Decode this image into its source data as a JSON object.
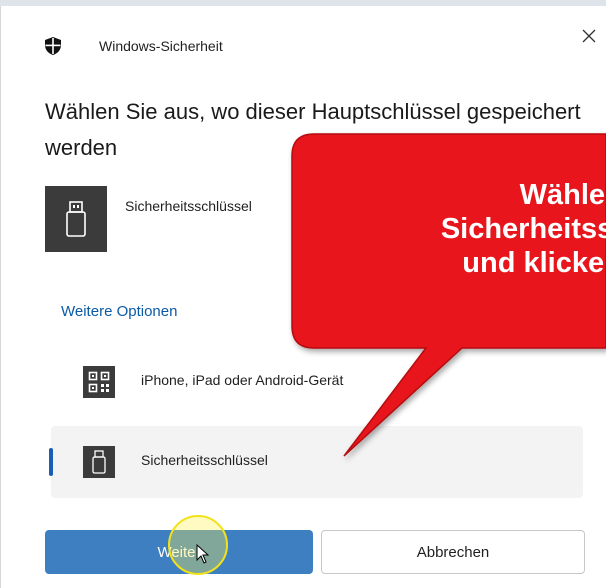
{
  "window": {
    "app_title": "Windows-Sicherheit",
    "close_glyph": "✕",
    "heading": "Wählen Sie aus, wo dieser Hauptschlüssel gespeichert werden"
  },
  "primary_option": {
    "label": "Sicherheitsschlüssel",
    "icon": "usb-key-icon"
  },
  "more_options": {
    "label": "Weitere Optionen"
  },
  "options": [
    {
      "label": "iPhone, iPad oder Android-Gerät",
      "icon": "qr-code-icon",
      "selected": false
    },
    {
      "label": "Sicherheitsschlüssel",
      "icon": "usb-key-icon",
      "selected": true
    }
  ],
  "buttons": {
    "primary": "Weiter",
    "secondary": "Abbrechen"
  },
  "callout": {
    "lines": [
      "Wählen Sie",
      "Sicherheitsschl",
      "und klicken au"
    ],
    "color": "#e8141b"
  },
  "colors": {
    "accent": "#3e7fc2",
    "link": "#0a5aa6",
    "selected_indicator": "#1a5fb4"
  }
}
